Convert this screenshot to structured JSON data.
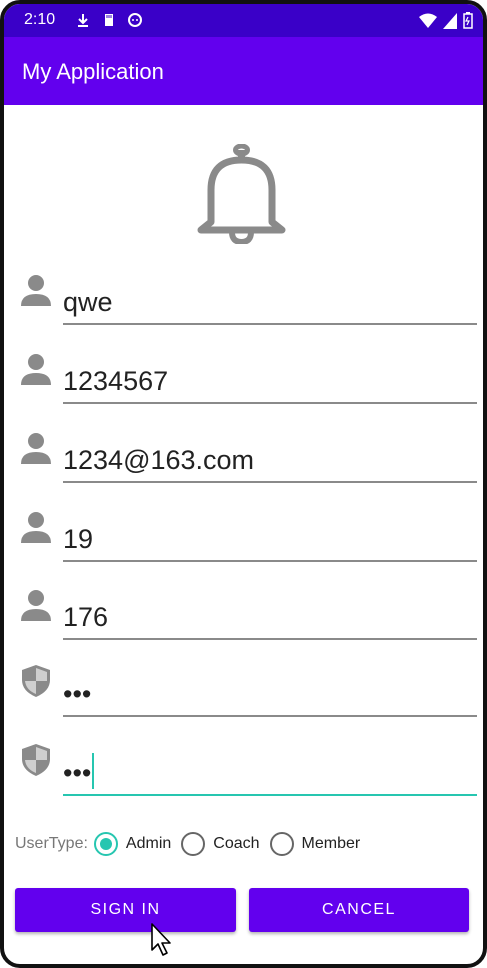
{
  "status_bar": {
    "time": "2:10",
    "icons": [
      "download-icon",
      "sd-card-icon",
      "face-icon",
      "wifi-icon",
      "signal-icon",
      "battery-icon"
    ]
  },
  "app_bar": {
    "title": "My Application"
  },
  "header_icon": "bell-icon",
  "fields": [
    {
      "icon": "person-icon",
      "value": "qwe"
    },
    {
      "icon": "person-icon",
      "value": "1234567"
    },
    {
      "icon": "person-icon",
      "value": "1234@163.com"
    },
    {
      "icon": "person-icon",
      "value": "19"
    },
    {
      "icon": "person-icon",
      "value": "176"
    },
    {
      "icon": "shield-icon",
      "value": "•••"
    },
    {
      "icon": "shield-icon",
      "value": "•••"
    }
  ],
  "user_type": {
    "label": "UserType:",
    "options": [
      {
        "label": "Admin",
        "checked": true
      },
      {
        "label": "Coach",
        "checked": false
      },
      {
        "label": "Member",
        "checked": false
      }
    ]
  },
  "buttons": {
    "sign_in": "SIGN IN",
    "cancel": "CANCEL"
  },
  "colors": {
    "primary": "#6200ee",
    "status_bar": "#3a00c8",
    "accent": "#26c6b0",
    "icon_gray": "#8a8a8a"
  }
}
